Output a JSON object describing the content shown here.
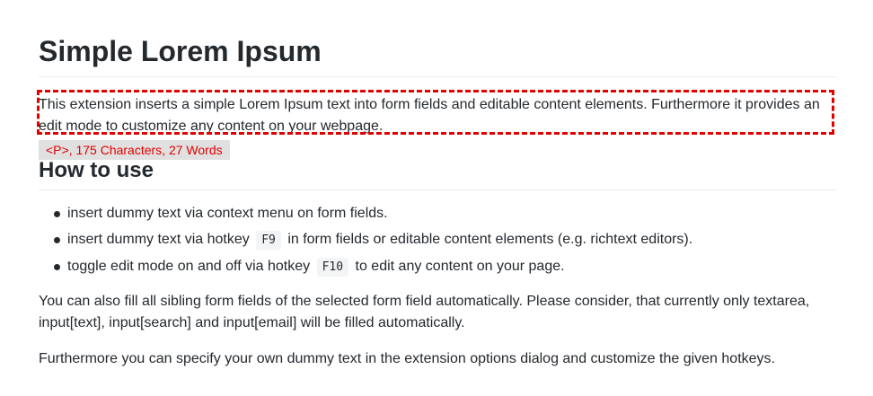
{
  "title": "Simple Lorem Ipsum",
  "intro": "This extension inserts a simple Lorem Ipsum text into form fields and editable content elements. Furthermore it provides an edit mode to customize any content on your webpage.",
  "element_badge": "<P>, 175 Characters, 27 Words",
  "colors": {
    "highlight": "#e00000",
    "badge_bg": "#e0e0e0",
    "text": "#24292e"
  },
  "how_to_use": {
    "heading": "How to use",
    "items": [
      {
        "before": "insert dummy text via context menu on form fields.",
        "code": "",
        "after": ""
      },
      {
        "before": "insert dummy text via hotkey",
        "code": "F9",
        "after": "in form fields or editable content elements (e.g. richtext editors)."
      },
      {
        "before": "toggle edit mode on and off via hotkey",
        "code": "F10",
        "after": "to edit any content on your page."
      }
    ]
  },
  "paragraphs": [
    "You can also fill all sibling form fields of the selected form field automatically. Please consider, that currently only textarea, input[text], input[search] and input[email] will be filled automatically.",
    "Furthermore you can specify your own dummy text in the extension options dialog and customize the given hotkeys."
  ]
}
